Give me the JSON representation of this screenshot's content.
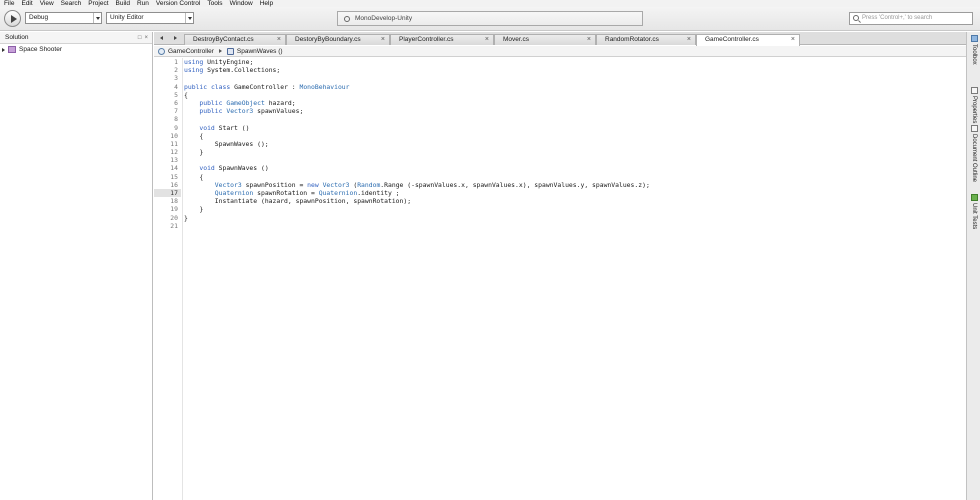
{
  "menu": [
    "File",
    "Edit",
    "View",
    "Search",
    "Project",
    "Build",
    "Run",
    "Version Control",
    "Tools",
    "Window",
    "Help"
  ],
  "toolbar": {
    "config": "Debug",
    "target": "Unity Editor",
    "title": "MonoDevelop-Unity",
    "search_placeholder": "Press 'Control+,' to search"
  },
  "solution": {
    "title": "Solution",
    "buttons": [
      "□",
      "×"
    ],
    "items": [
      {
        "label": "Space Shooter"
      }
    ]
  },
  "tabs": [
    {
      "label": "DestroyByContact.cs",
      "active": false
    },
    {
      "label": "DestoryByBoundary.cs",
      "active": false
    },
    {
      "label": "PlayerController.cs",
      "active": false
    },
    {
      "label": "Mover.cs",
      "active": false
    },
    {
      "label": "RandomRotator.cs",
      "active": false
    },
    {
      "label": "GameController.cs",
      "active": true
    }
  ],
  "tab_close_glyph": "×",
  "breadcrumb": {
    "class_name": "GameController",
    "method_name": "SpawnWaves ()"
  },
  "colors": {
    "keyword": "#3060c0",
    "type": "#2b6cb0",
    "plain": "#1a1a1a",
    "current_line": "#e2e2e2"
  },
  "editor": {
    "current_line": 17,
    "lines": [
      {
        "n": "1",
        "code": "using UnityEngine;"
      },
      {
        "n": "2",
        "code": "using System.Collections;"
      },
      {
        "n": "3",
        "code": ""
      },
      {
        "n": "4",
        "code": "public class GameController : MonoBehaviour"
      },
      {
        "n": "5",
        "code": "{"
      },
      {
        "n": "6",
        "code": "    public GameObject hazard;"
      },
      {
        "n": "7",
        "code": "    public Vector3 spawnValues;"
      },
      {
        "n": "8",
        "code": ""
      },
      {
        "n": "9",
        "code": "    void Start ()"
      },
      {
        "n": "10",
        "code": "    {"
      },
      {
        "n": "11",
        "code": "        SpawnWaves ();"
      },
      {
        "n": "12",
        "code": "    }"
      },
      {
        "n": "13",
        "code": ""
      },
      {
        "n": "14",
        "code": "    void SpawnWaves ()"
      },
      {
        "n": "15",
        "code": "    {"
      },
      {
        "n": "16",
        "code": "        Vector3 spawnPosition = new Vector3 (Random.Range (-spawnValues.x, spawnValues.x), spawnValues.y, spawnValues.z);"
      },
      {
        "n": "17",
        "code": "        Quaternion spawnRotation = Quaternion.identity ;"
      },
      {
        "n": "18",
        "code": "        Instantiate (hazard, spawnPosition, spawnRotation);"
      },
      {
        "n": "19",
        "code": "    }"
      },
      {
        "n": "20",
        "code": "}"
      },
      {
        "n": "21",
        "code": ""
      }
    ]
  },
  "right_dock": [
    {
      "label": "Toolbox",
      "icon": "toolbox-icon"
    },
    {
      "label": "Properties",
      "icon": "properties-icon"
    },
    {
      "label": "Document Outline",
      "icon": "document-outline-icon"
    },
    {
      "label": "Unit Tests",
      "icon": "unit-tests-icon"
    }
  ]
}
